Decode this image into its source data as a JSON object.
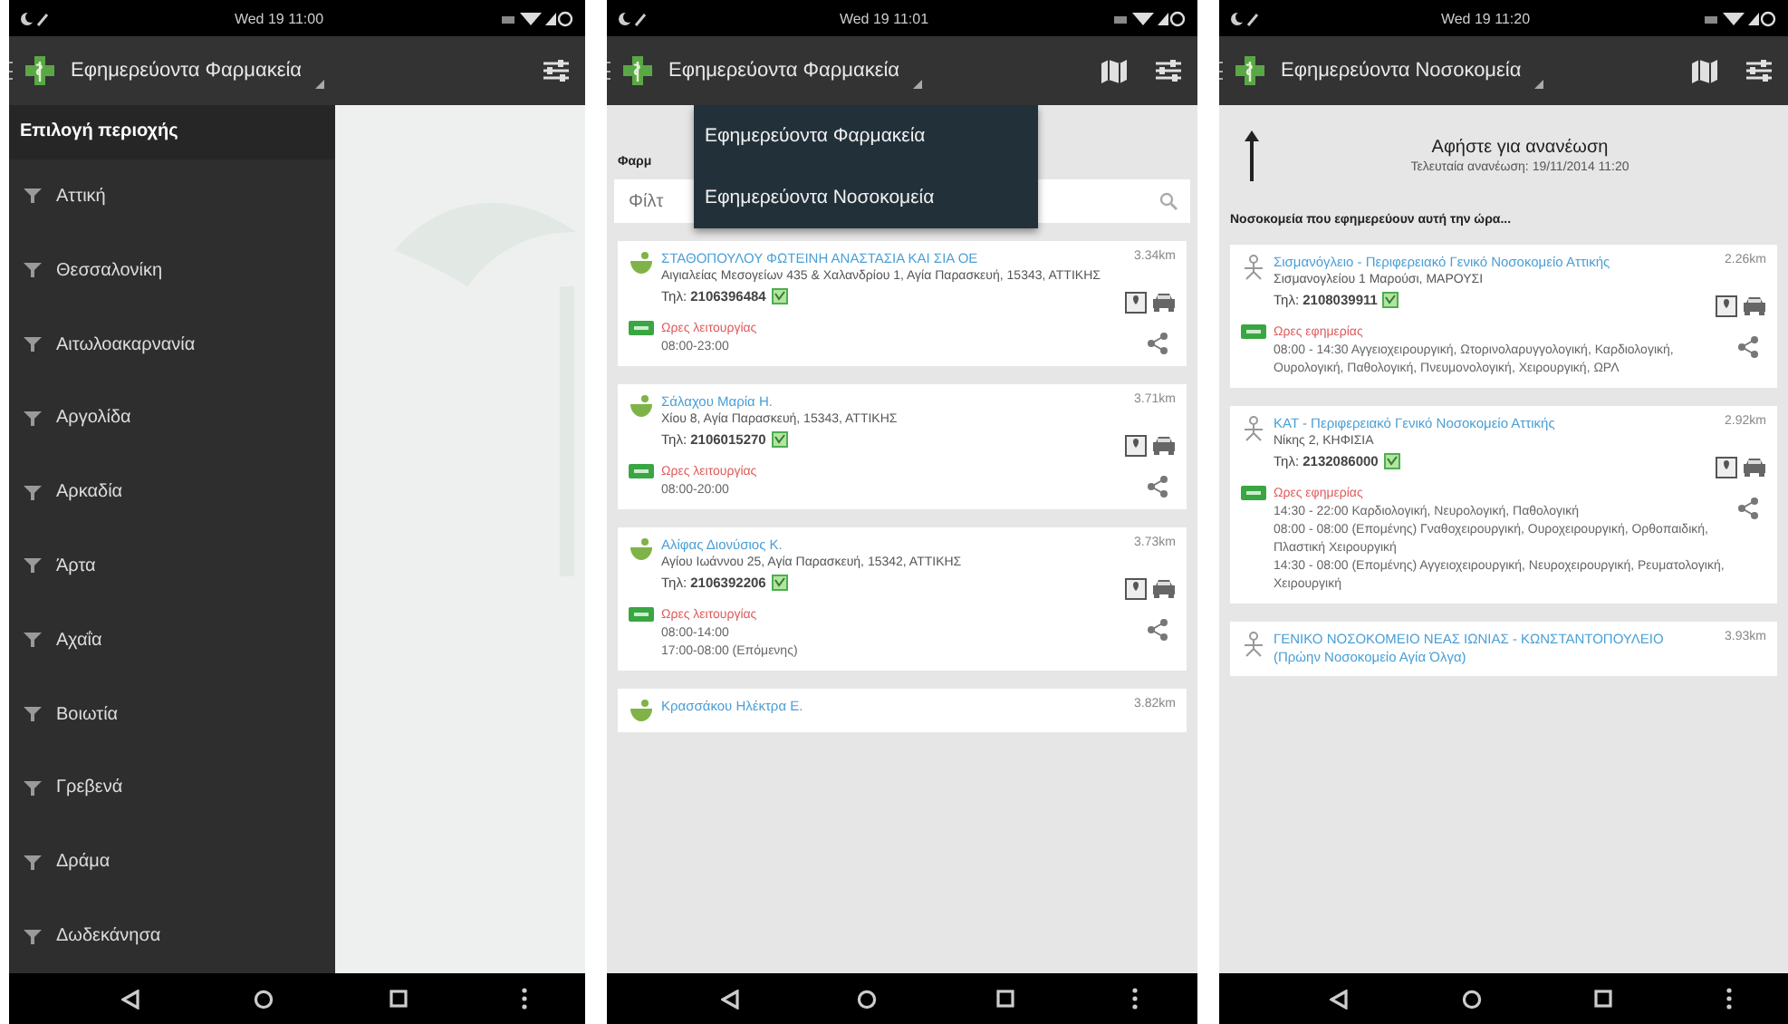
{
  "phones": [
    {
      "kind": "drawer",
      "status_time": "Wed 19 11:00",
      "app_bar": {
        "title": "Εφημερεύοντα Φαρμακεία",
        "show_map_action": false
      },
      "drawer": {
        "header": "Επιλογή περιοχής",
        "items": [
          "Αττική",
          "Θεσσαλονίκη",
          "Αιτωλοακαρνανία",
          "Αργολίδα",
          "Αρκαδία",
          "Άρτα",
          "Αχαΐα",
          "Βοιωτία",
          "Γρεβενά",
          "Δράμα",
          "Δωδεκάνησα"
        ]
      }
    },
    {
      "kind": "list",
      "status_time": "Wed 19 11:01",
      "app_bar": {
        "title": "Εφημερεύοντα Φαρμακεία",
        "show_map_action": true
      },
      "menu": {
        "items": [
          "Εφημερεύοντα Φαρμακεία",
          "Εφημερεύοντα Νοσοκομεία"
        ]
      },
      "section_header": "Φαρμ",
      "search": {
        "placeholder": "Φίλτ"
      },
      "cards": [
        {
          "kind": "pharmacy",
          "name": "ΣΤΑΘΟΠΟΥΛΟΥ ΦΩΤΕΙΝΗ ΑΝΑΣΤΑΣΙΑ ΚΑΙ ΣΙΑ ΟΕ",
          "distance": "3.34km",
          "address": "Αιγιαλείας Μεσογείων 435 & Χαλανδρίου 1, Αγία Παρασκευή, 15343, ΑΤΤΙΚΗΣ",
          "phone": "Τηλ: **2106396484**",
          "hours_label": "Ωρες λειτουργίας",
          "hours": [
            "08:00-23:00"
          ]
        },
        {
          "kind": "pharmacy",
          "name": "Σάλαχου Μαρία Η.",
          "distance": "3.71km",
          "address": "Χίου 8, Αγία Παρασκευή, 15343, ΑΤΤΙΚΗΣ",
          "phone": "Τηλ: **2106015270**",
          "hours_label": "Ωρες λειτουργίας",
          "hours": [
            "08:00-20:00"
          ]
        },
        {
          "kind": "pharmacy",
          "name": "Αλίφας Διονύσιος Κ.",
          "distance": "3.73km",
          "address": "Αγίου Ιωάννου 25, Αγία Παρασκευή, 15342, ΑΤΤΙΚΗΣ",
          "phone": "Τηλ: **2106392206**",
          "hours_label": "Ωρες λειτουργίας",
          "hours": [
            "08:00-14:00",
            "17:00-08:00 (Επόμενης)"
          ]
        },
        {
          "kind": "pharmacy",
          "name": "Κρασσάκου Ηλέκτρα Ε.",
          "distance": "3.82km"
        }
      ]
    },
    {
      "kind": "list",
      "status_time": "Wed 19 11:20",
      "app_bar": {
        "title": "Εφημερεύοντα Νοσοκομεία",
        "show_map_action": true
      },
      "refresh": {
        "title": "Αφήστε για ανανέωση",
        "subtitle": "Τελευταία ανανέωση: 19/11/2014 11:20"
      },
      "section_header": "Νοσοκομεία που εφημερεύουν αυτή την ώρα...",
      "cards": [
        {
          "kind": "hospital",
          "name": "Σισμανόγλειο - Περιφερειακό Γενικό Νοσοκομείο Αττικής",
          "distance": "2.26km",
          "address": "Σισμανογλείου 1 Μαρούσι, ΜΑΡΟΥΣΙ",
          "phone": "Τηλ: **2108039911**",
          "hours_label": "Ωρες εφημερίας",
          "hours": [
            "08:00 - 14:30 Αγγειοχειρουργική, Ωτορινολαρυγγολογική, Καρδιολογική, Ουρολογική, Παθολογική, Πνευμονολογική, Χειρουργική, ΩΡΛ"
          ]
        },
        {
          "kind": "hospital",
          "name": "ΚΑΤ - Περιφερειακό Γενικό Νοσοκομείο Αττικής",
          "distance": "2.92km",
          "address": "Νίκης 2, ΚΗΦΙΣΙΑ",
          "phone": "Τηλ: **2132086000**",
          "hours_label": "Ωρες εφημερίας",
          "hours": [
            "14:30 - 22:00 Καρδιολογική, Νευρολογική, Παθολογική",
            "08:00 - 08:00 (Επομένης) Γναθοχειρουργική, Ουροχειρουργική, Ορθοπαιδική, Πλαστική Χειρουργική",
            "14:30 - 08:00 (Επομένης) Αγγειοχειρουργική, Νευροχειρουργική, Ρευματολογική, Χειρουργική"
          ]
        },
        {
          "kind": "hospital",
          "name": "ΓΕΝΙΚΟ ΝΟΣΟΚΟΜΕΙΟ ΝΕΑΣ ΙΩΝΙΑΣ - ΚΩΝΣΤΑΝΤΟΠΟΥΛΕΙΟ (Πρώην Νοσοκομείο Αγία Όλγα)",
          "distance": "3.93km"
        }
      ]
    }
  ]
}
